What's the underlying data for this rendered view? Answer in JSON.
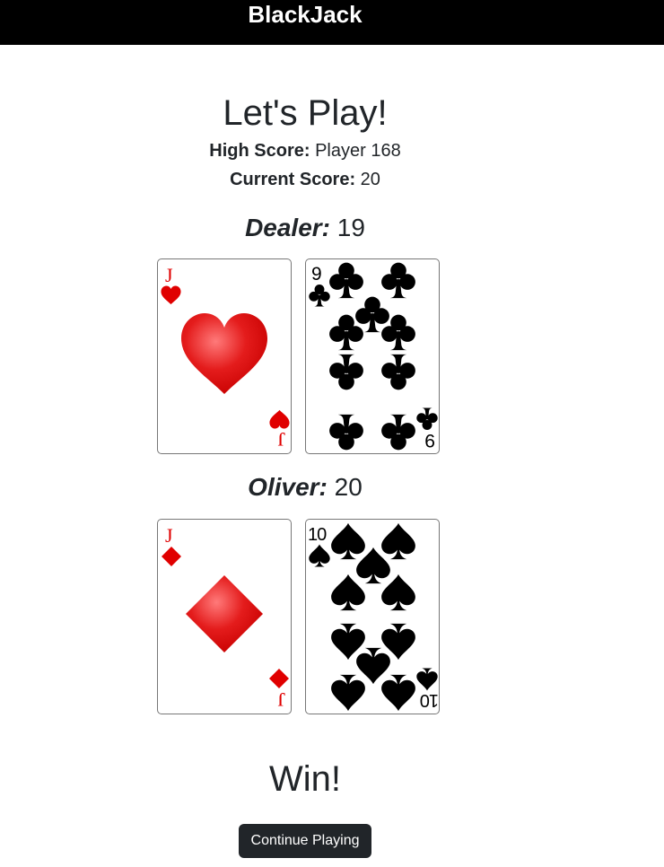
{
  "app": {
    "title": "BlackJack"
  },
  "main": {
    "heading": "Let's Play!",
    "high_score_label": "High Score:",
    "high_score_value": "Player 168",
    "current_score_label": "Current Score:",
    "current_score_value": "20"
  },
  "dealer": {
    "name": "Dealer:",
    "score": "19",
    "cards": [
      {
        "rank": "J",
        "suit": "hearts",
        "symbol": "♥",
        "color": "#e00000"
      },
      {
        "rank": "9",
        "suit": "clubs",
        "symbol": "♣",
        "color": "#000000"
      }
    ]
  },
  "player": {
    "name": "Oliver:",
    "score": "20",
    "cards": [
      {
        "rank": "J",
        "suit": "diamonds",
        "symbol": "♦",
        "color": "#e00000"
      },
      {
        "rank": "10",
        "suit": "spades",
        "symbol": "♠",
        "color": "#000000"
      }
    ]
  },
  "result": {
    "text": "Win!"
  },
  "actions": {
    "continue_label": "Continue Playing"
  }
}
